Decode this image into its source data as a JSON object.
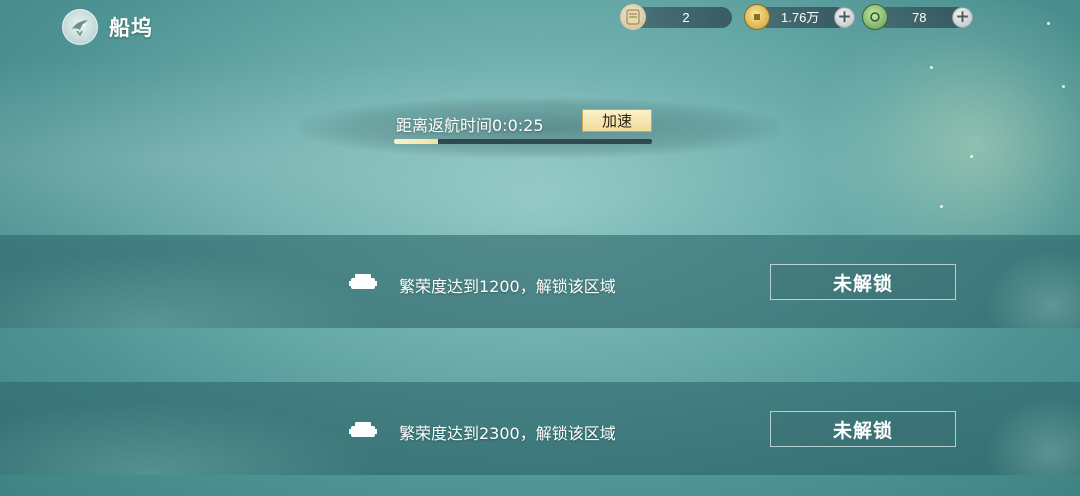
{
  "header": {
    "title": "船坞"
  },
  "resources": [
    {
      "icon": "scroll-icon",
      "value": "2",
      "has_plus": false
    },
    {
      "icon": "copper-coin-icon",
      "value": "1.76万",
      "has_plus": true
    },
    {
      "icon": "jade-icon",
      "value": "78",
      "has_plus": true
    }
  ],
  "voyage": {
    "return_label": "距离返航时间0:0:25",
    "speed_up_label": "加速",
    "progress_percent": 17
  },
  "regions": [
    {
      "requirement": "繁荣度达到1200，解锁该区域",
      "status_label": "未解锁"
    },
    {
      "requirement": "繁荣度达到2300，解锁该区域",
      "status_label": "未解锁"
    }
  ],
  "colors": {
    "accent_button": "#f2dc9c",
    "progress_fill": "#f8f3d0"
  }
}
